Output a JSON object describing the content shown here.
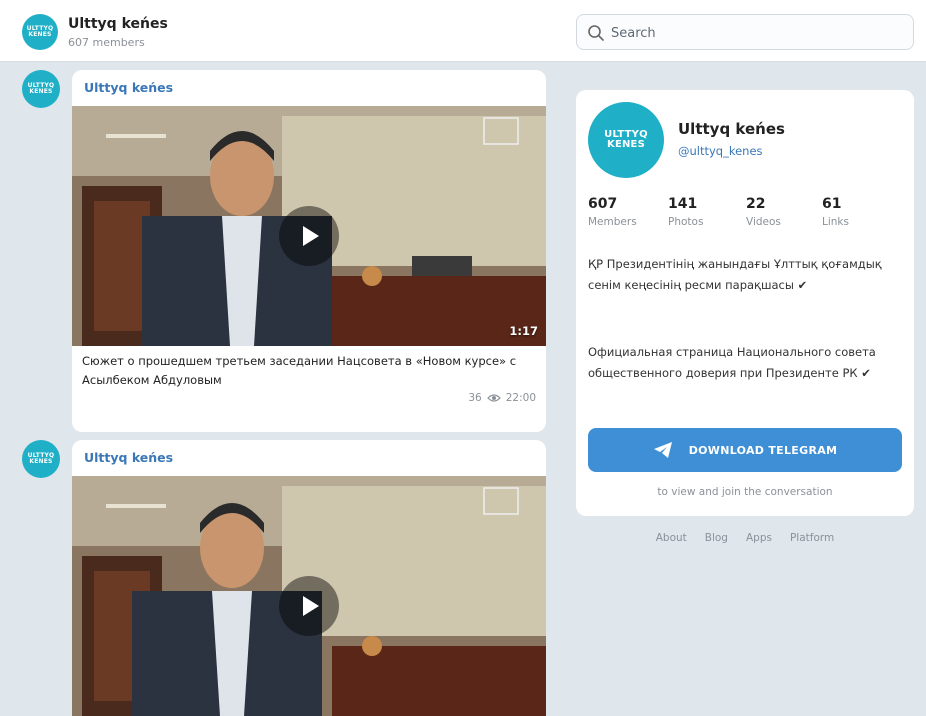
{
  "header": {
    "avatar_line1": "ULTTYQ",
    "avatar_line2": "KENES",
    "title": "Ulttyq keńes",
    "subtitle": "607 members"
  },
  "search": {
    "placeholder": "Search"
  },
  "messages": [
    {
      "author": "Ulttyq keńes",
      "duration": "1:17",
      "caption": "Сюжет о прошедшем третьем заседании Нацсовета в «Новом курсе» с Асылбеком Абдуловым",
      "views": "36",
      "time": "22:00"
    },
    {
      "author": "Ulttyq keńes"
    }
  ],
  "channel": {
    "avatar_line1": "ULTTYQ",
    "avatar_line2": "KENES",
    "name": "Ulttyq keńes",
    "handle": "@ulttyq_kenes",
    "stats": [
      {
        "value": "607",
        "label": "Members"
      },
      {
        "value": "141",
        "label": "Photos"
      },
      {
        "value": "22",
        "label": "Videos"
      },
      {
        "value": "61",
        "label": "Links"
      }
    ],
    "description_kz": "ҚР Президентінің жанындағы Ұлттық қоғамдық сенім кеңесінің ресми парақшасы ✔",
    "description_ru": "Официальная страница Национального совета общественного доверия при Президенте РК ✔",
    "button_label": "DOWNLOAD TELEGRAM",
    "button_note": "to view and join the conversation"
  },
  "footer": [
    "About",
    "Blog",
    "Apps",
    "Platform"
  ],
  "colors": {
    "accent": "#3f8fd6",
    "avatar": "#1fb0c7",
    "link": "#3a77b8",
    "background": "#dfe6ec"
  }
}
